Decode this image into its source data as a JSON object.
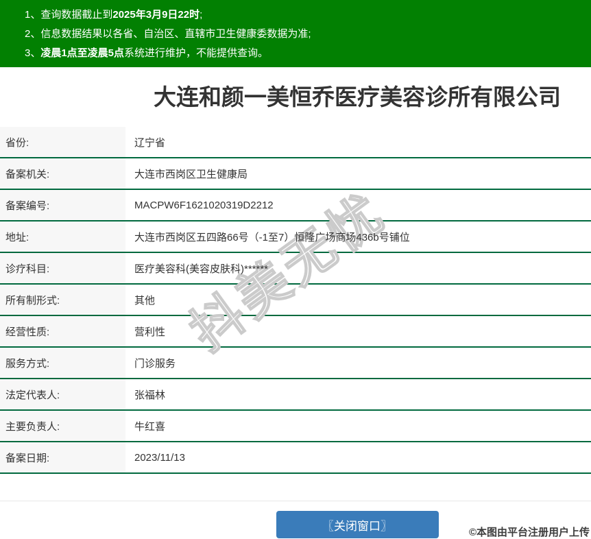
{
  "notices": {
    "items": [
      {
        "num": "1、",
        "pre": "查询数据截止到",
        "bold": "2025年3月9日22时",
        "post": ";"
      },
      {
        "num": "2、",
        "pre": "信息数据结果以各省、自治区、直辖市卫生健康委数据为准;",
        "bold": "",
        "post": ""
      },
      {
        "num": "3、",
        "pre": "",
        "bold": "凌晨1点至凌晨5点",
        "post": "系统进行维护，不能提供查询。"
      }
    ]
  },
  "page": {
    "title": "大连和颜一美恒乔医疗美容诊所有限公司"
  },
  "record": {
    "fields": [
      {
        "label": "省份:",
        "value": "辽宁省"
      },
      {
        "label": "备案机关:",
        "value": "大连市西岗区卫生健康局"
      },
      {
        "label": "备案编号:",
        "value": "MACPW6F1621020319D2212"
      },
      {
        "label": "地址:",
        "value": "大连市西岗区五四路66号（-1至7）恒隆广场商场436b号铺位"
      },
      {
        "label": "诊疗科目:",
        "value": "医疗美容科(美容皮肤科)******"
      },
      {
        "label": "所有制形式:",
        "value": "其他"
      },
      {
        "label": "经营性质:",
        "value": "营利性"
      },
      {
        "label": "服务方式:",
        "value": "门诊服务"
      },
      {
        "label": "法定代表人:",
        "value": "张福林"
      },
      {
        "label": "主要负责人:",
        "value": "牛红喜"
      },
      {
        "label": "备案日期:",
        "value": "2023/11/13"
      }
    ]
  },
  "watermark": {
    "text": "抖美无忧"
  },
  "footer": {
    "close_button_label": "〖关闭窗口〗",
    "upload_note": "©本图由平台注册用户上传"
  },
  "colors": {
    "header_green": "#028002",
    "row_line_green": "#00693e",
    "button_blue": "#3a7cba"
  }
}
